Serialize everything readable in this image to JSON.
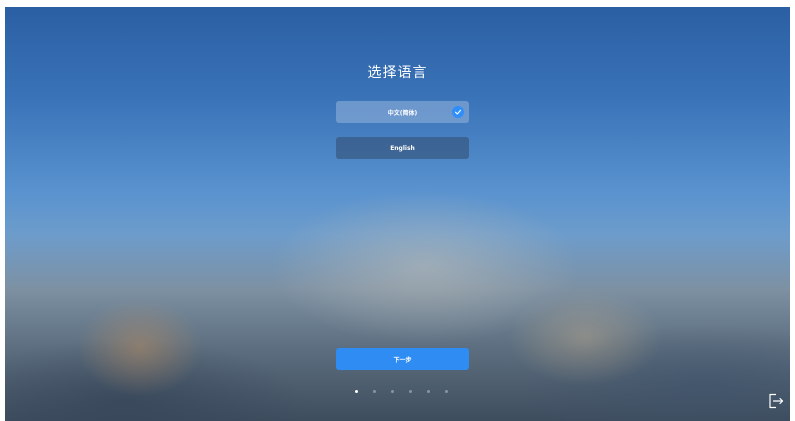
{
  "page": {
    "title": "选择语言"
  },
  "languages": [
    {
      "label": "中文(简体)",
      "selected": true
    },
    {
      "label": "English",
      "selected": false
    }
  ],
  "actions": {
    "next_label": "下一步"
  },
  "pager": {
    "total_steps": 6,
    "current_step": 1
  },
  "icons": {
    "selected": "check-icon",
    "exit": "exit-icon"
  },
  "colors": {
    "accent": "#2e8cf2"
  }
}
